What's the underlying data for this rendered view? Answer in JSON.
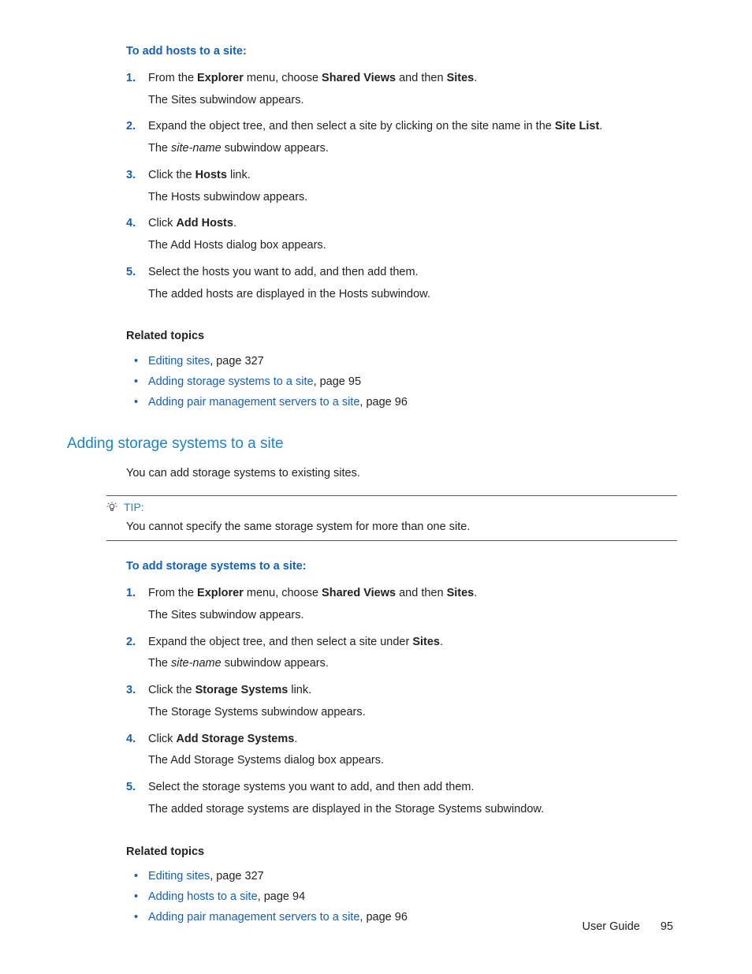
{
  "proc1": {
    "title": "To add hosts to a site:",
    "steps": [
      {
        "num": "1.",
        "pre": "From the ",
        "b1": "Explorer",
        "mid1": " menu, choose ",
        "b2": "Shared Views",
        "mid2": " and then ",
        "b3": "Sites",
        "post": ".",
        "sub": "The Sites subwindow appears."
      },
      {
        "num": "2.",
        "pre": "Expand the object tree, and then select a site by clicking on the site name in the ",
        "b1": "Site List",
        "post": ".",
        "sub_pre": "The ",
        "sub_i": "site-name",
        "sub_post": " subwindow appears."
      },
      {
        "num": "3.",
        "pre": "Click the ",
        "b1": "Hosts",
        "post": " link.",
        "sub": "The Hosts subwindow appears."
      },
      {
        "num": "4.",
        "pre": "Click ",
        "b1": "Add Hosts",
        "post": ".",
        "sub": "The Add Hosts dialog box appears."
      },
      {
        "num": "5.",
        "main": "Select the hosts you want to add, and then add them.",
        "sub": "The added hosts are displayed in the Hosts subwindow."
      }
    ]
  },
  "related_head": "Related topics",
  "related1": [
    {
      "link": "Editing sites",
      "rest": ", page 327"
    },
    {
      "link": "Adding storage systems to a site",
      "rest": ", page 95"
    },
    {
      "link": "Adding pair management servers to a site",
      "rest": ", page 96"
    }
  ],
  "section2_head": "Adding storage systems to a site",
  "section2_intro": "You can add storage systems to existing sites.",
  "tip_label": "TIP:",
  "tip_text": "You cannot specify the same storage system for more than one site.",
  "proc2": {
    "title": "To add storage systems to a site:",
    "steps": [
      {
        "num": "1.",
        "pre": "From the ",
        "b1": "Explorer",
        "mid1": " menu, choose ",
        "b2": "Shared Views",
        "mid2": " and then ",
        "b3": "Sites",
        "post": ".",
        "sub": "The Sites subwindow appears."
      },
      {
        "num": "2.",
        "pre": "Expand the object tree, and then select a site under ",
        "b1": "Sites",
        "post": ".",
        "sub_pre": "The ",
        "sub_i": "site-name",
        "sub_post": " subwindow appears."
      },
      {
        "num": "3.",
        "pre": "Click the ",
        "b1": "Storage Systems",
        "post": " link.",
        "sub": "The Storage Systems subwindow appears."
      },
      {
        "num": "4.",
        "pre": "Click ",
        "b1": "Add Storage Systems",
        "post": ".",
        "sub": "The Add Storage Systems dialog box appears."
      },
      {
        "num": "5.",
        "main": "Select the storage systems you want to add, and then add them.",
        "sub": "The added storage systems are displayed in the Storage Systems subwindow."
      }
    ]
  },
  "related2": [
    {
      "link": "Editing sites",
      "rest": ", page 327"
    },
    {
      "link": "Adding hosts to a site",
      "rest": ", page 94"
    },
    {
      "link": "Adding pair management servers to a site",
      "rest": ", page 96"
    }
  ],
  "footer_label": "User Guide",
  "footer_page": "95"
}
